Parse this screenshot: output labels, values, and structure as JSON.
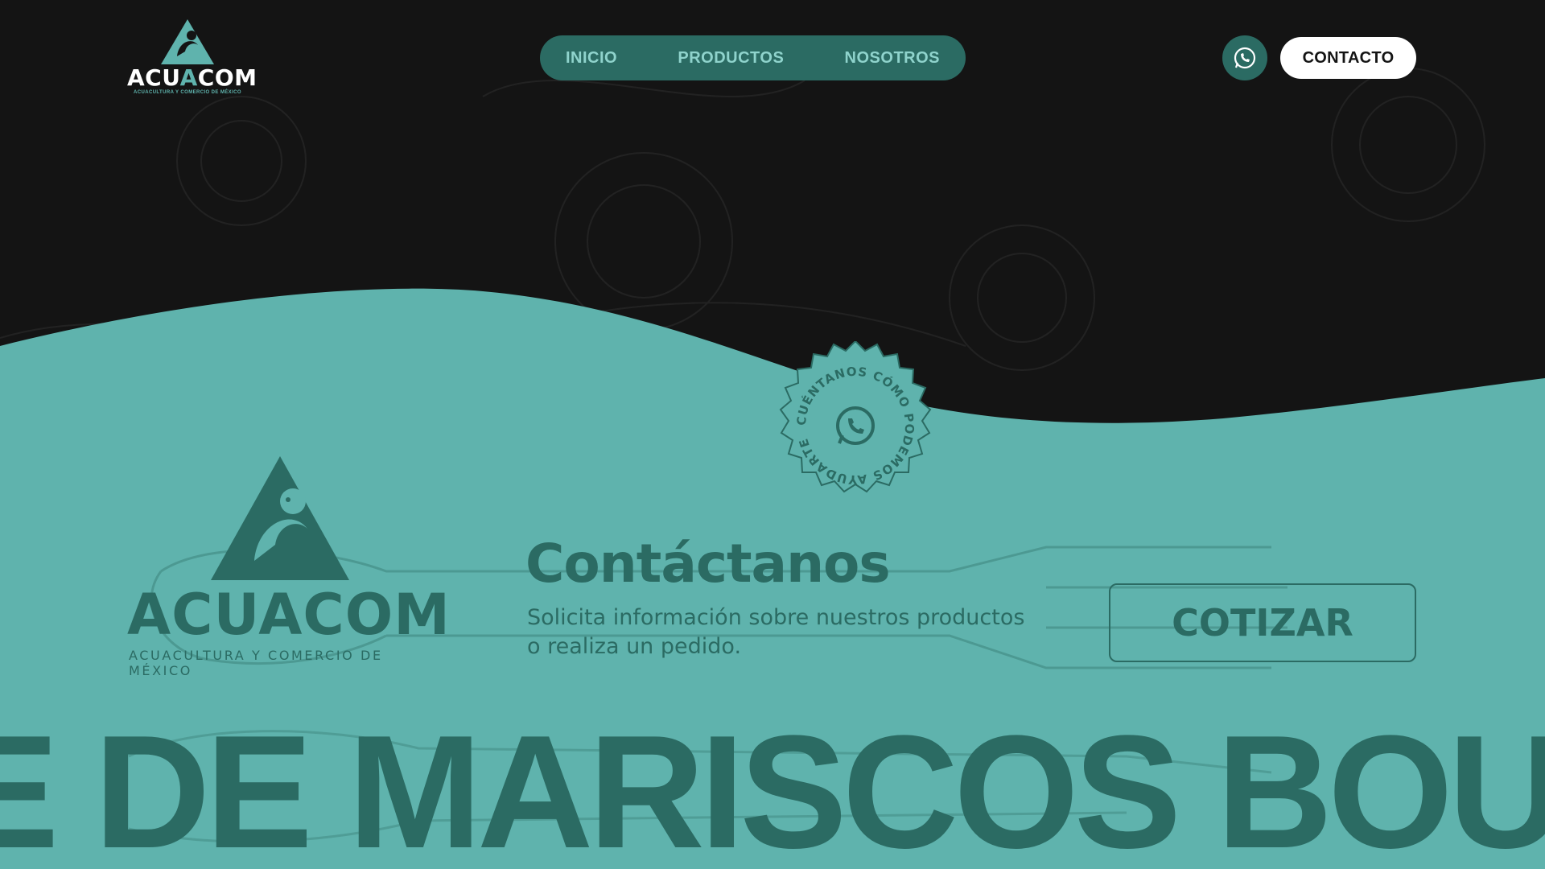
{
  "header": {
    "logo": {
      "brand_pre": "ACU",
      "brand_accent": "A",
      "brand_post": "COM",
      "tagline": "ACUACULTURA Y COMERCIO DE MÉXICO"
    },
    "nav": [
      {
        "label": "INICIO"
      },
      {
        "label": "PRODUCTOS"
      },
      {
        "label": "NOSOTROS"
      }
    ],
    "whatsapp_icon": "whatsapp-icon",
    "contact_label": "CONTACTO"
  },
  "badge": {
    "text": "CUÉNTANOS CÓMO PODEMOS AYUDARTE",
    "icon": "whatsapp-icon"
  },
  "contact_section": {
    "logo": {
      "brand": "ACUACOM",
      "tagline": "ACUACULTURA Y COMERCIO DE MÉXICO"
    },
    "title": "Contáctanos",
    "subtitle_line1": "Solicita información sobre nuestros productos",
    "subtitle_line2": "o realiza un pedido.",
    "quote_label": "COTIZAR"
  },
  "marquee": {
    "text": "E DE MARISCOS BOU"
  },
  "colors": {
    "dark_bg": "#141414",
    "teal_light": "#5fb3ad",
    "teal_dark": "#2b6b63",
    "nav_text": "#8fd3cc",
    "white": "#ffffff"
  }
}
